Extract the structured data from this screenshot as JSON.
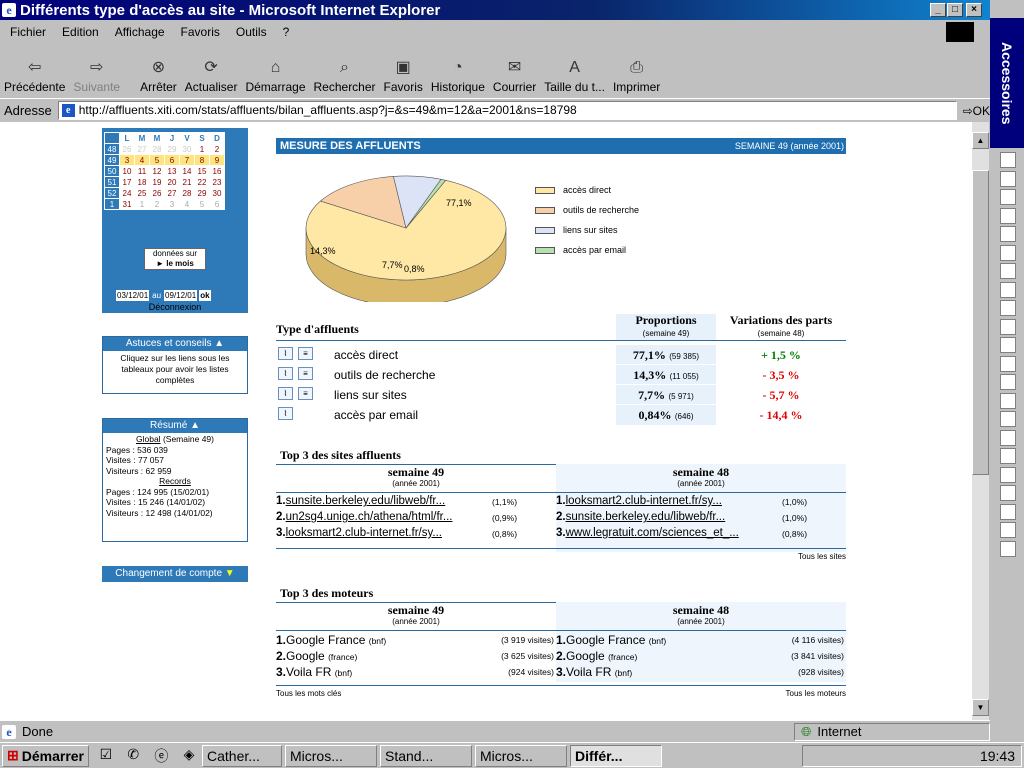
{
  "window": {
    "title": "Différents type d'accès au site - Microsoft Internet Explorer"
  },
  "menu": [
    "Fichier",
    "Edition",
    "Affichage",
    "Favoris",
    "Outils",
    "?"
  ],
  "toolbar": {
    "back": "Précédente",
    "forward": "Suivante",
    "stop": "Arrêter",
    "refresh": "Actualiser",
    "home": "Démarrage",
    "search": "Rechercher",
    "favorites": "Favoris",
    "history": "Historique",
    "mail": "Courrier",
    "size": "Taille du t...",
    "print": "Imprimer"
  },
  "address": {
    "label": "Adresse",
    "url": "http://affluents.xiti.com/stats/affluents/bilan_affluents.asp?j=&s=49&m=12&a=2001&ns=18798",
    "go": "OK"
  },
  "status": {
    "text": "Done",
    "zone": "Internet"
  },
  "taskbar": {
    "start": "Démarrer",
    "tasks": [
      "Cather...",
      "Micros...",
      "Stand...",
      "Micros...",
      "Différ..."
    ],
    "clock": "19:43"
  },
  "sidepanel": {
    "title": "Accessoires"
  },
  "calendar": {
    "headers": [
      "L",
      "M",
      "M",
      "J",
      "V",
      "S",
      "D"
    ],
    "weeks": [
      {
        "num": "48",
        "days": [
          "26",
          "27",
          "28",
          "29",
          "30",
          "1",
          "2"
        ]
      },
      {
        "num": "49",
        "days": [
          "3",
          "4",
          "5",
          "6",
          "7",
          "8",
          "9"
        ]
      },
      {
        "num": "50",
        "days": [
          "10",
          "11",
          "12",
          "13",
          "14",
          "15",
          "16"
        ]
      },
      {
        "num": "51",
        "days": [
          "17",
          "18",
          "19",
          "20",
          "21",
          "22",
          "23"
        ]
      },
      {
        "num": "52",
        "days": [
          "24",
          "25",
          "26",
          "27",
          "28",
          "29",
          "30"
        ]
      },
      {
        "num": "1",
        "days": [
          "31",
          "1",
          "2",
          "3",
          "4",
          "5",
          "6"
        ]
      }
    ],
    "data_on": "données sur",
    "month_link": "► le mois",
    "date_from": "03/12/01",
    "date_sep": "au",
    "date_to": "09/12/01",
    "ok": "ok",
    "logout": "Déconnexion"
  },
  "tips": {
    "title": "Astuces et conseils",
    "text": "Cliquez sur les liens sous les tableaux pour avoir les listes complètes"
  },
  "summary": {
    "title": "Résumé",
    "global": "Global",
    "global_week": "(Semaine 49)",
    "pages": "Pages : 536 039",
    "visits": "Visites : 77 057",
    "visitors": "Visiteurs : 62 959",
    "records": "Records",
    "rec_pages": "Pages : 124 995 (15/02/01)",
    "rec_visits": "Visites : 15 246 (14/01/02)",
    "rec_visitors": "Visiteurs : 12 498 (14/01/02)"
  },
  "change_account": "Changement de compte",
  "main": {
    "title": "MESURE DES AFFLUENTS",
    "week": "SEMAINE 49 (année 2001)"
  },
  "chart_data": {
    "type": "pie",
    "series": [
      {
        "name": "accès direct",
        "value": 77.1,
        "label": "77,1%",
        "color": "#ffe7a6"
      },
      {
        "name": "outils de recherche",
        "value": 14.3,
        "label": "14,3%",
        "color": "#f7cfa8"
      },
      {
        "name": "liens sur sites",
        "value": 7.7,
        "label": "7,7%",
        "color": "#dde3f7"
      },
      {
        "name": "accès par email",
        "value": 0.8,
        "label": "0,8%",
        "color": "#b7e0b0"
      }
    ]
  },
  "affluents": {
    "title": "Type d'affluents",
    "col_prop": "Proportions",
    "col_prop_sub": "(semaine 49)",
    "col_var": "Variations des parts",
    "col_var_sub": "(semaine 48)",
    "rows": [
      {
        "name": "accès direct",
        "pct": "77,1%",
        "count": "(59 385)",
        "var": "+ 1,5 %",
        "var_pos": true
      },
      {
        "name": "outils de recherche",
        "pct": "14,3%",
        "count": "(11 055)",
        "var": "- 3,5 %",
        "var_pos": false
      },
      {
        "name": "liens sur sites",
        "pct": "7,7%",
        "count": "(5 971)",
        "var": "- 5,7 %",
        "var_pos": false
      },
      {
        "name": "accès par email",
        "pct": "0,84%",
        "count": "(646)",
        "var": "- 14,4 %",
        "var_pos": false
      }
    ]
  },
  "top_sites": {
    "title": "Top 3 des sites affluents",
    "w49": "semaine 49",
    "w49_sub": "(année 2001)",
    "w48": "semaine 48",
    "w48_sub": "(année 2001)",
    "left": [
      {
        "n": "1.",
        "url": "sunsite.berkeley.edu/libweb/fr...",
        "pct": "(1,1%)"
      },
      {
        "n": "2.",
        "url": "un2sg4.unige.ch/athena/html/fr...",
        "pct": "(0,9%)"
      },
      {
        "n": "3.",
        "url": "looksmart2.club-internet.fr/sy...",
        "pct": "(0,8%)"
      }
    ],
    "right": [
      {
        "n": "1.",
        "url": "looksmart2.club-internet.fr/sy...",
        "pct": "(1,0%)"
      },
      {
        "n": "2.",
        "url": "sunsite.berkeley.edu/libweb/fr...",
        "pct": "(1,0%)"
      },
      {
        "n": "3.",
        "url": "www.legratuit.com/sciences_et_...",
        "pct": "(0,8%)"
      }
    ],
    "all": "Tous les sites"
  },
  "top_engines": {
    "title": "Top 3 des moteurs",
    "w49": "semaine 49",
    "w49_sub": "(année 2001)",
    "w48": "semaine 48",
    "w48_sub": "(année 2001)",
    "left": [
      {
        "n": "1.",
        "name": "Google France",
        "tag": "(bnf)",
        "v": "(3 919 visites)"
      },
      {
        "n": "2.",
        "name": "Google",
        "tag": "(france)",
        "v": "(3 625 visites)"
      },
      {
        "n": "3.",
        "name": "Voila FR",
        "tag": "(bnf)",
        "v": "(924 visites)"
      }
    ],
    "right": [
      {
        "n": "1.",
        "name": "Google France",
        "tag": "(bnf)",
        "v": "(4 116 visites)"
      },
      {
        "n": "2.",
        "name": "Google",
        "tag": "(france)",
        "v": "(3 841 visites)"
      },
      {
        "n": "3.",
        "name": "Voila FR",
        "tag": "(bnf)",
        "v": "(928 visites)"
      }
    ],
    "all_keywords": "Tous les mots clés",
    "all_engines": "Tous les moteurs"
  }
}
